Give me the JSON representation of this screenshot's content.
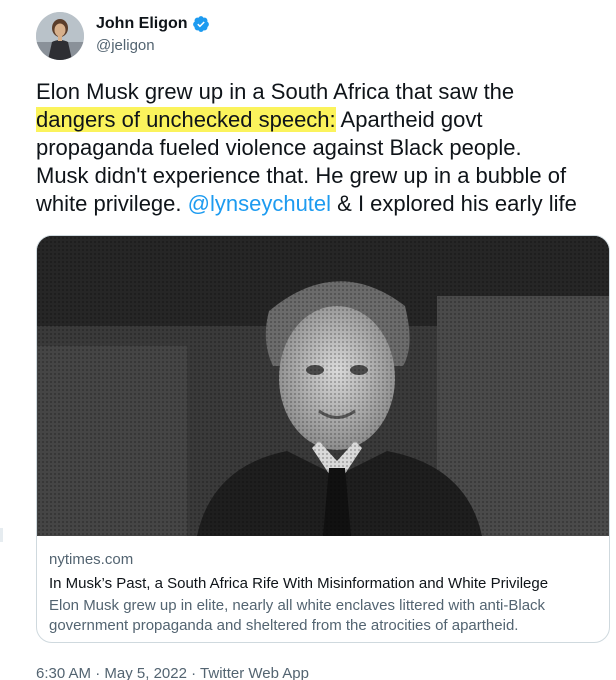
{
  "author": {
    "display_name": "John Eligon",
    "handle": "@jeligon",
    "verified": true
  },
  "tweet": {
    "line1": "Elon Musk grew up in a South Africa that saw the",
    "highlighted": "dangers of unchecked speech:",
    "line2_rest": " Apartheid govt",
    "line3": "propaganda fueled violence against Black people.",
    "line4": "Musk didn't experience that. He grew up in a bubble of",
    "line5_start": "white privilege. ",
    "mention": "@lynseychutel",
    "line5_end": " & I explored his early life"
  },
  "card": {
    "domain": "nytimes.com",
    "title": "In Musk’s Past, a South Africa Rife With Misinformation and White Privilege",
    "description": "Elon Musk grew up in elite, nearly all white enclaves littered with anti-Black government propaganda and sheltered from the atrocities of apartheid."
  },
  "meta": {
    "time": "6:30 AM",
    "separator1": "·",
    "date": "May 5, 2022",
    "separator2": "·",
    "source": "Twitter Web App"
  },
  "colors": {
    "link": "#1d9bf0",
    "highlight": "#fbf35c",
    "verified": "#1d9bf0",
    "secondary_text": "#536471"
  }
}
